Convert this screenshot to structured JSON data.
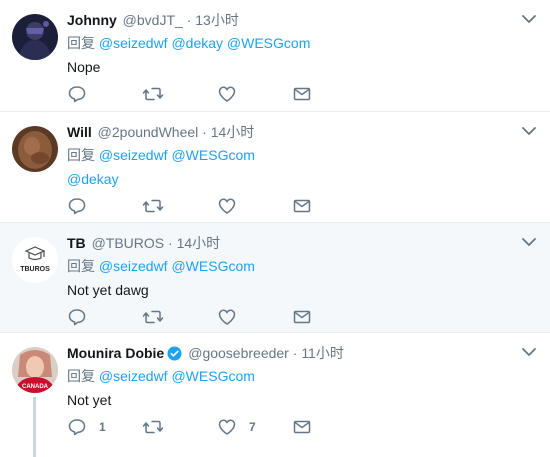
{
  "reply_prefix": "回复",
  "tweets": [
    {
      "name": "Johnny",
      "handle": "@bvdJT_",
      "dot": "·",
      "time": "13小时",
      "mentions": "@seizedwf @dekay @WESGcom",
      "text": "Nope",
      "reply_count": "",
      "like_count": ""
    },
    {
      "name": "Will",
      "handle": "@2poundWheel",
      "dot": "·",
      "time": "14小时",
      "mentions": "@seizedwf @WESGcom",
      "text": "@dekay",
      "reply_count": "",
      "like_count": ""
    },
    {
      "name": "TB",
      "handle": "@TBUROS",
      "dot": "·",
      "time": "14小时",
      "mentions": "@seizedwf @WESGcom",
      "text": "Not yet dawg",
      "avatar_text": "TBUROS",
      "reply_count": "",
      "like_count": ""
    },
    {
      "name": "Mounira Dobie",
      "handle": "@goosebreeder",
      "dot": "·",
      "time": "11小时",
      "mentions": "@seizedwf @WESGcom",
      "text": "Not yet",
      "avatar_text": "CANADA",
      "verified": true,
      "reply_count": "1",
      "like_count": "7"
    }
  ],
  "colors": {
    "link": "#1da1f2",
    "muted": "#657786",
    "divider": "#e6ecf0",
    "highlight_bg": "#f5f8fa",
    "thread_line": "#ccd6dd"
  },
  "icons": [
    "reply-icon",
    "retweet-icon",
    "like-icon",
    "direct-message-icon",
    "chevron-down-icon",
    "verified-badge-icon"
  ]
}
